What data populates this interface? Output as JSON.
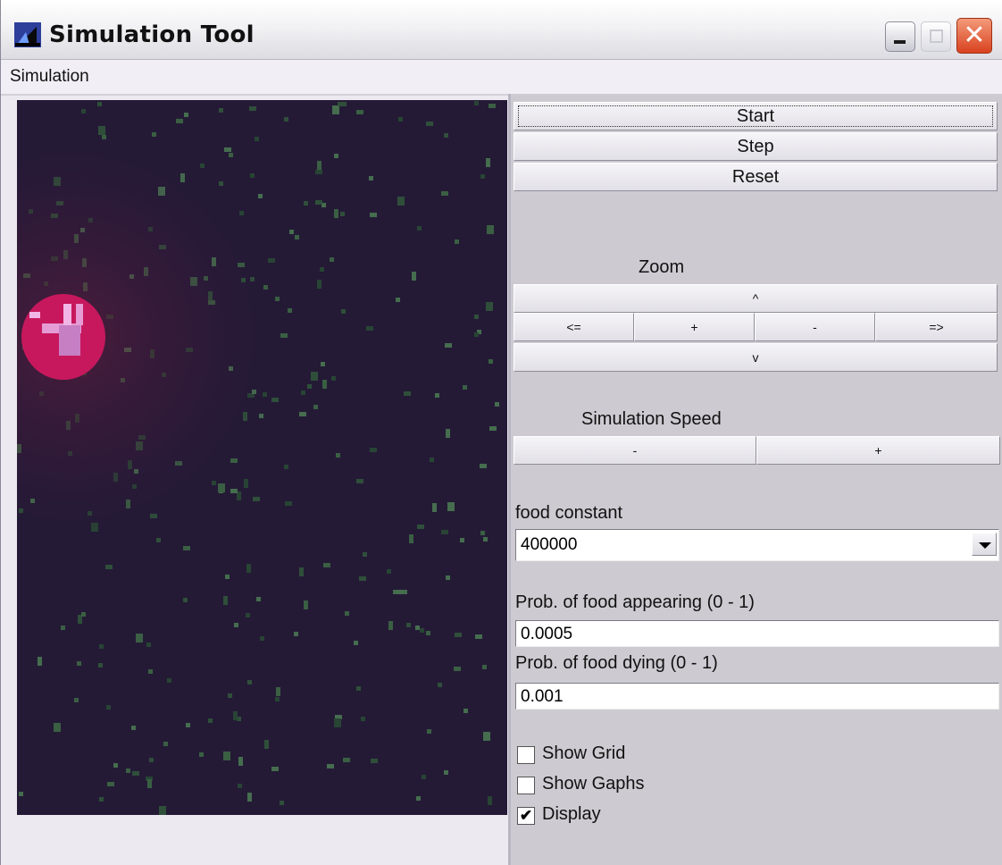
{
  "window": {
    "title": "Simulation Tool",
    "close_glyph": "✕",
    "accent_colors": {
      "close": "#d9421f",
      "canvas_bg": "#241a36",
      "organism": "#c7185e",
      "organism_core": "#e59bd4",
      "food": "#3f6b42"
    }
  },
  "menu": {
    "items": [
      "Simulation"
    ]
  },
  "controls": {
    "start": "Start",
    "step": "Step",
    "reset": "Reset",
    "zoom_label": "Zoom",
    "zoom_up": "^",
    "zoom_left": "<=",
    "zoom_in": "+",
    "zoom_out": "-",
    "zoom_right": "=>",
    "zoom_down": "v",
    "speed_label": "Simulation Speed",
    "speed_down": "-",
    "speed_up": "+",
    "food_constant_label": "food constant",
    "food_constant_value": "400000",
    "prob_appear_label": "Prob. of food appearing (0 - 1)",
    "prob_appear_value": "0.0005",
    "prob_die_label": "Prob. of food dying (0 - 1)",
    "prob_die_value": "0.001",
    "checkboxes": [
      {
        "label": "Show Grid",
        "checked": false
      },
      {
        "label": "Show Gaphs",
        "checked": false
      },
      {
        "label": "Display",
        "checked": true
      }
    ],
    "check_glyph": "✔"
  },
  "icons": {
    "app": "app-icon",
    "minimize": "minimize-icon",
    "maximize": "maximize-icon",
    "close": "close-icon",
    "dropdown": "chevron-down-icon"
  }
}
